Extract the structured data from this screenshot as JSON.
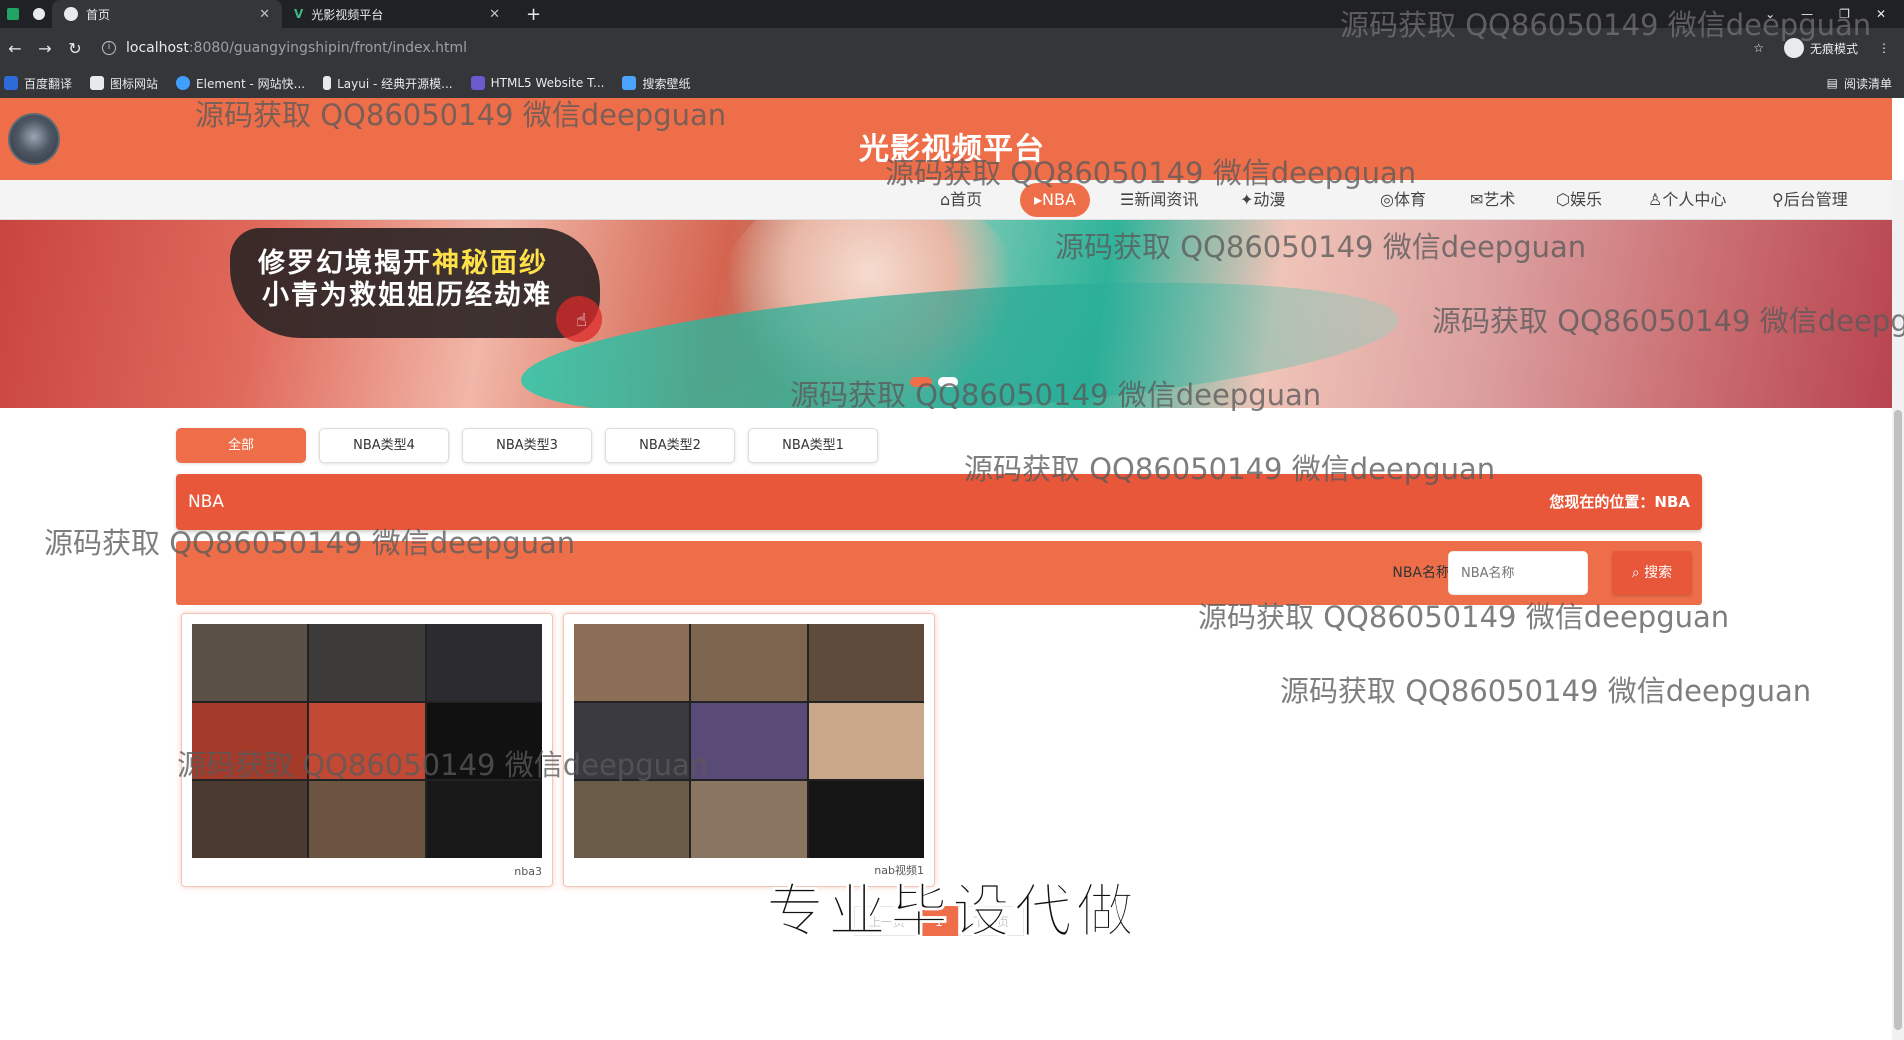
{
  "browser": {
    "tabs": [
      {
        "label": "首页",
        "active": true
      },
      {
        "label": "光影视频平台",
        "active": false
      }
    ],
    "new_tab": "+",
    "window_controls": [
      "—",
      "❐",
      "✕"
    ],
    "url_host": "localhost",
    "url_path": ":8080/guangyingshipin/front/index.html",
    "incognito_label": "无痕模式",
    "bookmarks": [
      {
        "label": "百度翻译",
        "color": "#2f6bd8"
      },
      {
        "label": "图标网站",
        "color": "#e8eaed"
      },
      {
        "label": "Element - 网站快...",
        "color": "#409eff"
      },
      {
        "label": "Layui - 经典开源模...",
        "color": "#e8eaed"
      },
      {
        "label": "HTML5 Website T...",
        "color": "#6a5acd"
      },
      {
        "label": "搜索壁纸",
        "color": "#4aa3ff"
      }
    ],
    "reading_list": "阅读清单"
  },
  "site": {
    "title": "光影视频平台",
    "accent": "#ef6e4a",
    "nav": [
      {
        "label": "首页",
        "icon": "home-icon"
      },
      {
        "label": "NBA",
        "icon": "play-icon",
        "active": true
      },
      {
        "label": "新闻资讯",
        "icon": "news-icon"
      },
      {
        "label": "动漫",
        "icon": "anime-icon"
      },
      {
        "label": "体育",
        "icon": "sport-icon"
      },
      {
        "label": "艺术",
        "icon": "mail-icon"
      },
      {
        "label": "娱乐",
        "icon": "shield-icon"
      },
      {
        "label": "个人中心",
        "icon": "user-icon"
      },
      {
        "label": "后台管理",
        "icon": "link-icon"
      }
    ],
    "banner": {
      "line1_a": "修罗幻境揭开",
      "line1_b": "神秘面纱",
      "line2_a": "小青为救姐姐",
      "line2_b": "历经劫难"
    },
    "filter_tabs": [
      {
        "label": "全部",
        "active": true
      },
      {
        "label": "NBA类型4"
      },
      {
        "label": "NBA类型3"
      },
      {
        "label": "NBA类型2"
      },
      {
        "label": "NBA类型1"
      }
    ],
    "crumb": {
      "section": "NBA",
      "location_prefix": "您现在的位置：",
      "location": "NBA"
    },
    "search": {
      "label": "NBA名称",
      "placeholder": "NBA名称",
      "button": "搜索"
    },
    "cards": [
      {
        "caption": "nba3"
      },
      {
        "caption": "nab视频1"
      }
    ],
    "pager": {
      "prev": "上一页",
      "current": "1",
      "next": "下一页"
    }
  },
  "watermark_text": "源码获取 QQ86050149 微信deepguan",
  "overlay_caption": "专业毕设代做"
}
